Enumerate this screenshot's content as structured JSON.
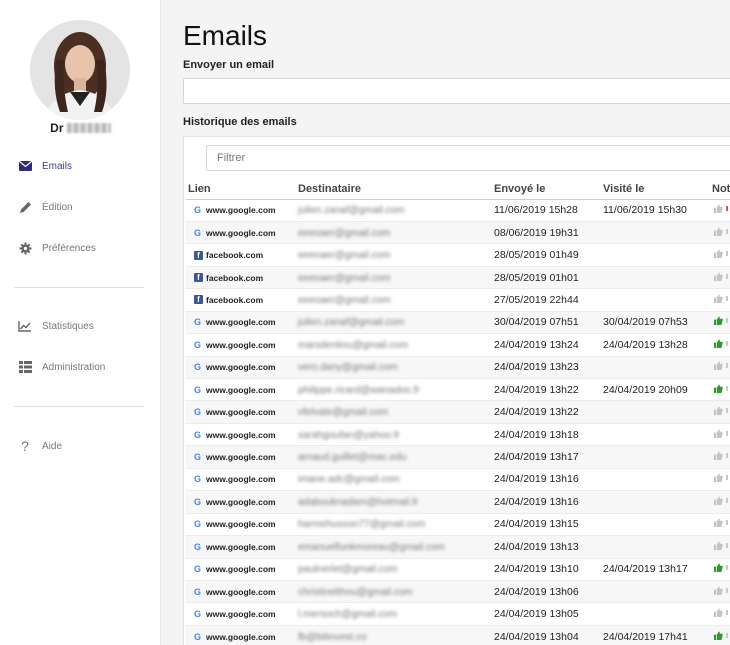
{
  "user": {
    "name_prefix": "Dr"
  },
  "sidebar": {
    "items": [
      {
        "label": "Emails",
        "icon": "envelope-icon"
      },
      {
        "label": "Édition",
        "icon": "pencil-icon"
      },
      {
        "label": "Préférences",
        "icon": "gear-icon"
      },
      {
        "label": "Statistiques",
        "icon": "chart-line-icon"
      },
      {
        "label": "Administration",
        "icon": "list-icon"
      },
      {
        "label": "Aide",
        "icon": "question-icon"
      }
    ]
  },
  "main": {
    "title": "Emails",
    "send_label": "Envoyer un email",
    "history_label": "Historique des emails",
    "filter_placeholder": "Filtrer",
    "columns": [
      "Lien",
      "Destinataire",
      "Envoyé le",
      "Visité le",
      "Not"
    ],
    "rows": [
      {
        "site": "google",
        "link": "www.google.com",
        "dest": "julien.zanaf@gmail.com",
        "sent": "11/06/2019 15h28",
        "visited": "11/06/2019 15h30",
        "liked": false,
        "flag": "red"
      },
      {
        "site": "google",
        "link": "www.google.com",
        "dest": "eeeoaer@gmail.com",
        "sent": "08/06/2019 19h31",
        "visited": "",
        "liked": false,
        "flag": ""
      },
      {
        "site": "facebook",
        "link": "facebook.com",
        "dest": "eeeoaer@gmail.com",
        "sent": "28/05/2019 01h49",
        "visited": "",
        "liked": false,
        "flag": ""
      },
      {
        "site": "facebook",
        "link": "facebook.com",
        "dest": "eeeoaer@gmail.com",
        "sent": "28/05/2019 01h01",
        "visited": "",
        "liked": false,
        "flag": ""
      },
      {
        "site": "facebook",
        "link": "facebook.com",
        "dest": "eeeoaer@gmail.com",
        "sent": "27/05/2019 22h44",
        "visited": "",
        "liked": false,
        "flag": ""
      },
      {
        "site": "google",
        "link": "www.google.com",
        "dest": "julien.zanaf@gmail.com",
        "sent": "30/04/2019 07h51",
        "visited": "30/04/2019 07h53",
        "liked": true,
        "flag": ""
      },
      {
        "site": "google",
        "link": "www.google.com",
        "dest": "marsdenliou@gmail.com",
        "sent": "24/04/2019 13h24",
        "visited": "24/04/2019 13h28",
        "liked": true,
        "flag": ""
      },
      {
        "site": "google",
        "link": "www.google.com",
        "dest": "vero.dany@gmail.com",
        "sent": "24/04/2019 13h23",
        "visited": "",
        "liked": false,
        "flag": ""
      },
      {
        "site": "google",
        "link": "www.google.com",
        "dest": "philippe.ricard@wanadoo.fr",
        "sent": "24/04/2019 13h22",
        "visited": "24/04/2019 20h09",
        "liked": true,
        "flag": ""
      },
      {
        "site": "google",
        "link": "www.google.com",
        "dest": "vfelvate@gmail.com",
        "sent": "24/04/2019 13h22",
        "visited": "",
        "liked": false,
        "flag": ""
      },
      {
        "site": "google",
        "link": "www.google.com",
        "dest": "sarahgoufan@yahoo.fr",
        "sent": "24/04/2019 13h18",
        "visited": "",
        "liked": false,
        "flag": ""
      },
      {
        "site": "google",
        "link": "www.google.com",
        "dest": "arnaud.guillet@mac.edu",
        "sent": "24/04/2019 13h17",
        "visited": "",
        "liked": false,
        "flag": ""
      },
      {
        "site": "google",
        "link": "www.google.com",
        "dest": "imane.adc@gmail.com",
        "sent": "24/04/2019 13h16",
        "visited": "",
        "liked": false,
        "flag": ""
      },
      {
        "site": "google",
        "link": "www.google.com",
        "dest": "adabouknadam@hotmail.fr",
        "sent": "24/04/2019 13h16",
        "visited": "",
        "liked": false,
        "flag": ""
      },
      {
        "site": "google",
        "link": "www.google.com",
        "dest": "harmehusson77@gmail.com",
        "sent": "24/04/2019 13h15",
        "visited": "",
        "liked": false,
        "flag": ""
      },
      {
        "site": "google",
        "link": "www.google.com",
        "dest": "emanuelfunkmoreau@gmail.com",
        "sent": "24/04/2019 13h13",
        "visited": "",
        "liked": false,
        "flag": ""
      },
      {
        "site": "google",
        "link": "www.google.com",
        "dest": "paulnerlet@gmail.com",
        "sent": "24/04/2019 13h10",
        "visited": "24/04/2019 13h17",
        "liked": true,
        "flag": ""
      },
      {
        "site": "google",
        "link": "www.google.com",
        "dest": "christinelthou@gmail.com",
        "sent": "24/04/2019 13h06",
        "visited": "",
        "liked": false,
        "flag": ""
      },
      {
        "site": "google",
        "link": "www.google.com",
        "dest": "l.mersoch@gmail.com",
        "sent": "24/04/2019 13h05",
        "visited": "",
        "liked": false,
        "flag": ""
      },
      {
        "site": "google",
        "link": "www.google.com",
        "dest": "fb@bitinvest.co",
        "sent": "24/04/2019 13h04",
        "visited": "24/04/2019 17h41",
        "liked": true,
        "flag": ""
      }
    ]
  },
  "colors": {
    "accent": "#2c2c7a",
    "like": "#2e9a2e",
    "flag_red": "#d9534f"
  }
}
